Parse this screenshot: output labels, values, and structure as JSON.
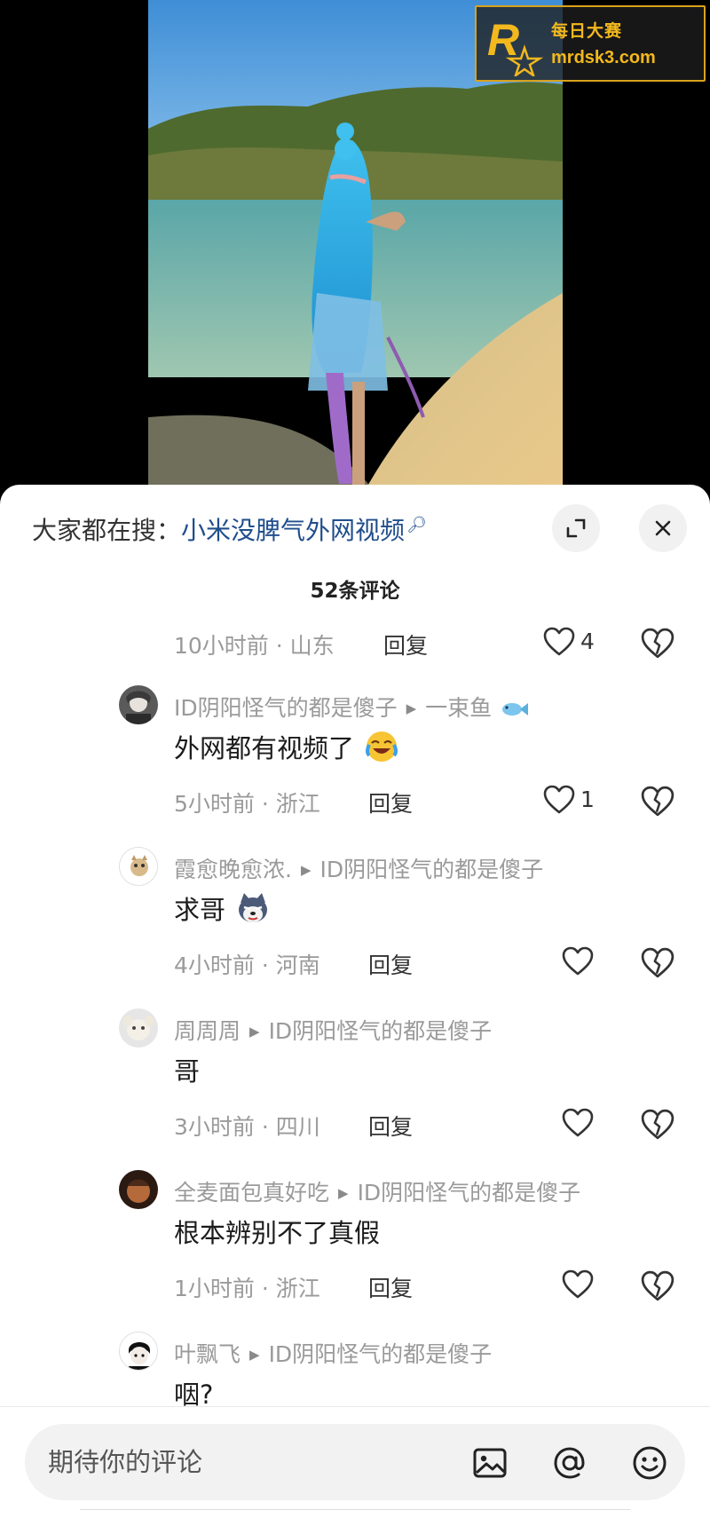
{
  "watermark": {
    "title": "每日大赛",
    "url": "mrdsk3.com"
  },
  "sheet": {
    "search_prefix": "大家都在搜：",
    "search_keyword": "小米没脾气外网视频",
    "comment_count": "52条评论",
    "top_meta": {
      "time_loc": "10小时前 · 山东",
      "reply": "回复",
      "likes": "4"
    },
    "comments": [
      {
        "user": "ID阴阳怪气的都是傻子",
        "reply_to": "一束鱼",
        "text": "外网都有视频了",
        "time_loc": "5小时前 · 浙江",
        "reply": "回复",
        "likes": "1"
      },
      {
        "user": "霞愈晚愈浓.",
        "reply_to": "ID阴阳怪气的都是傻子",
        "text": "求哥",
        "time_loc": "4小时前 · 河南",
        "reply": "回复",
        "likes": ""
      },
      {
        "user": "周周周",
        "reply_to": "ID阴阳怪气的都是傻子",
        "text": "哥",
        "time_loc": "3小时前 · 四川",
        "reply": "回复",
        "likes": ""
      },
      {
        "user": "全麦面包真好吃",
        "reply_to": "ID阴阳怪气的都是傻子",
        "text": "根本辨别不了真假",
        "time_loc": "1小时前 · 浙江",
        "reply": "回复",
        "likes": ""
      },
      {
        "user": "叶飘飞",
        "reply_to": "ID阴阳怪气的都是傻子",
        "text": "咽?",
        "time_loc": "",
        "reply": "",
        "likes": ""
      }
    ]
  },
  "input": {
    "placeholder": "期待你的评论"
  },
  "icons": {
    "expand": "expand-icon",
    "close": "close-icon",
    "like": "heart-icon",
    "dislike": "broken-heart-icon",
    "image": "image-icon",
    "at": "at-icon",
    "emoji": "emoji-icon",
    "search": "search-icon"
  },
  "colors": {
    "keyword": "#1f4e8c",
    "watermark": "#f2b81d",
    "meta": "#9a9a9a"
  }
}
